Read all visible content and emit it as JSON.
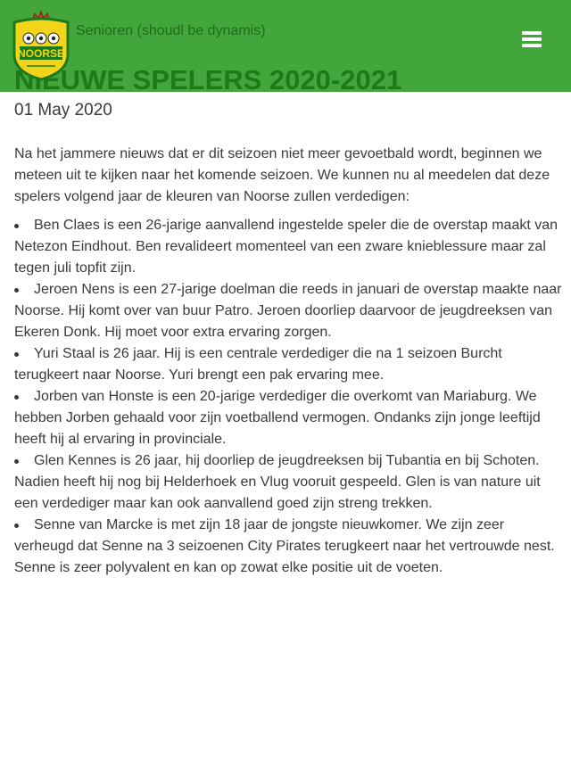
{
  "header": {
    "logo_text": "NOORSE",
    "subtitle": "Senioren (shoudl be dynamis)",
    "menu_icon": "hamburger-icon",
    "colors": {
      "bar": "#43a63d",
      "logo_shield": "#f2d51b",
      "logo_border": "#1d7a18"
    }
  },
  "article": {
    "title": "NIEUWE SPELERS 2020-2021",
    "date": "01 May 2020",
    "intro": "Na het jammere nieuws dat er dit seizoen niet meer gevoetbald wordt, beginnen we meteen uit te kijken naar het komende seizoen. We kunnen nu al meedelen dat deze spelers volgend jaar de kleuren van Noorse zullen verdedigen:",
    "items": [
      "Ben Claes is een 26-jarige aanvallend ingestelde speler die de overstap maakt van Netezon Eindhout. Ben revalideert momenteel van een zware knieblessure maar zal tegen juli topfit zijn.",
      "Jeroen Nens is een 27-jarige doelman die reeds in januari de overstap maakte naar Noorse. Hij komt over van buur Patro. Jeroen doorliep daarvoor de jeugdreeksen van Ekeren Donk. Hij moet voor extra ervaring zorgen.",
      "Yuri Staal is 26 jaar. Hij is een centrale verdediger die na 1 seizoen Burcht terugkeert naar Noorse. Yuri brengt een pak ervaring mee.",
      "Jorben van Honste is een 20-jarige verdediger die overkomt van Mariaburg. We hebben Jorben gehaald voor zijn voetballend vermogen. Ondanks zijn jonge leeftijd heeft hij al ervaring in provinciale.",
      "Glen Kennes is 26 jaar, hij doorliep de jeugdreeksen bij Tubantia en bij Schoten. Nadien heeft hij nog bij Helderhoek en Vlug vooruit gespeeld. Glen is van nature uit een verdediger maar kan ook aanvallend goed zijn streng trekken.",
      "Senne van Marcke is met zijn 18 jaar de jongste nieuwkomer. We zijn zeer verheugd dat Senne na 3 seizoenen City Pirates terugkeert naar het vertrouwde nest. Senne is zeer polyvalent en kan op zowat elke positie uit de voeten."
    ]
  }
}
